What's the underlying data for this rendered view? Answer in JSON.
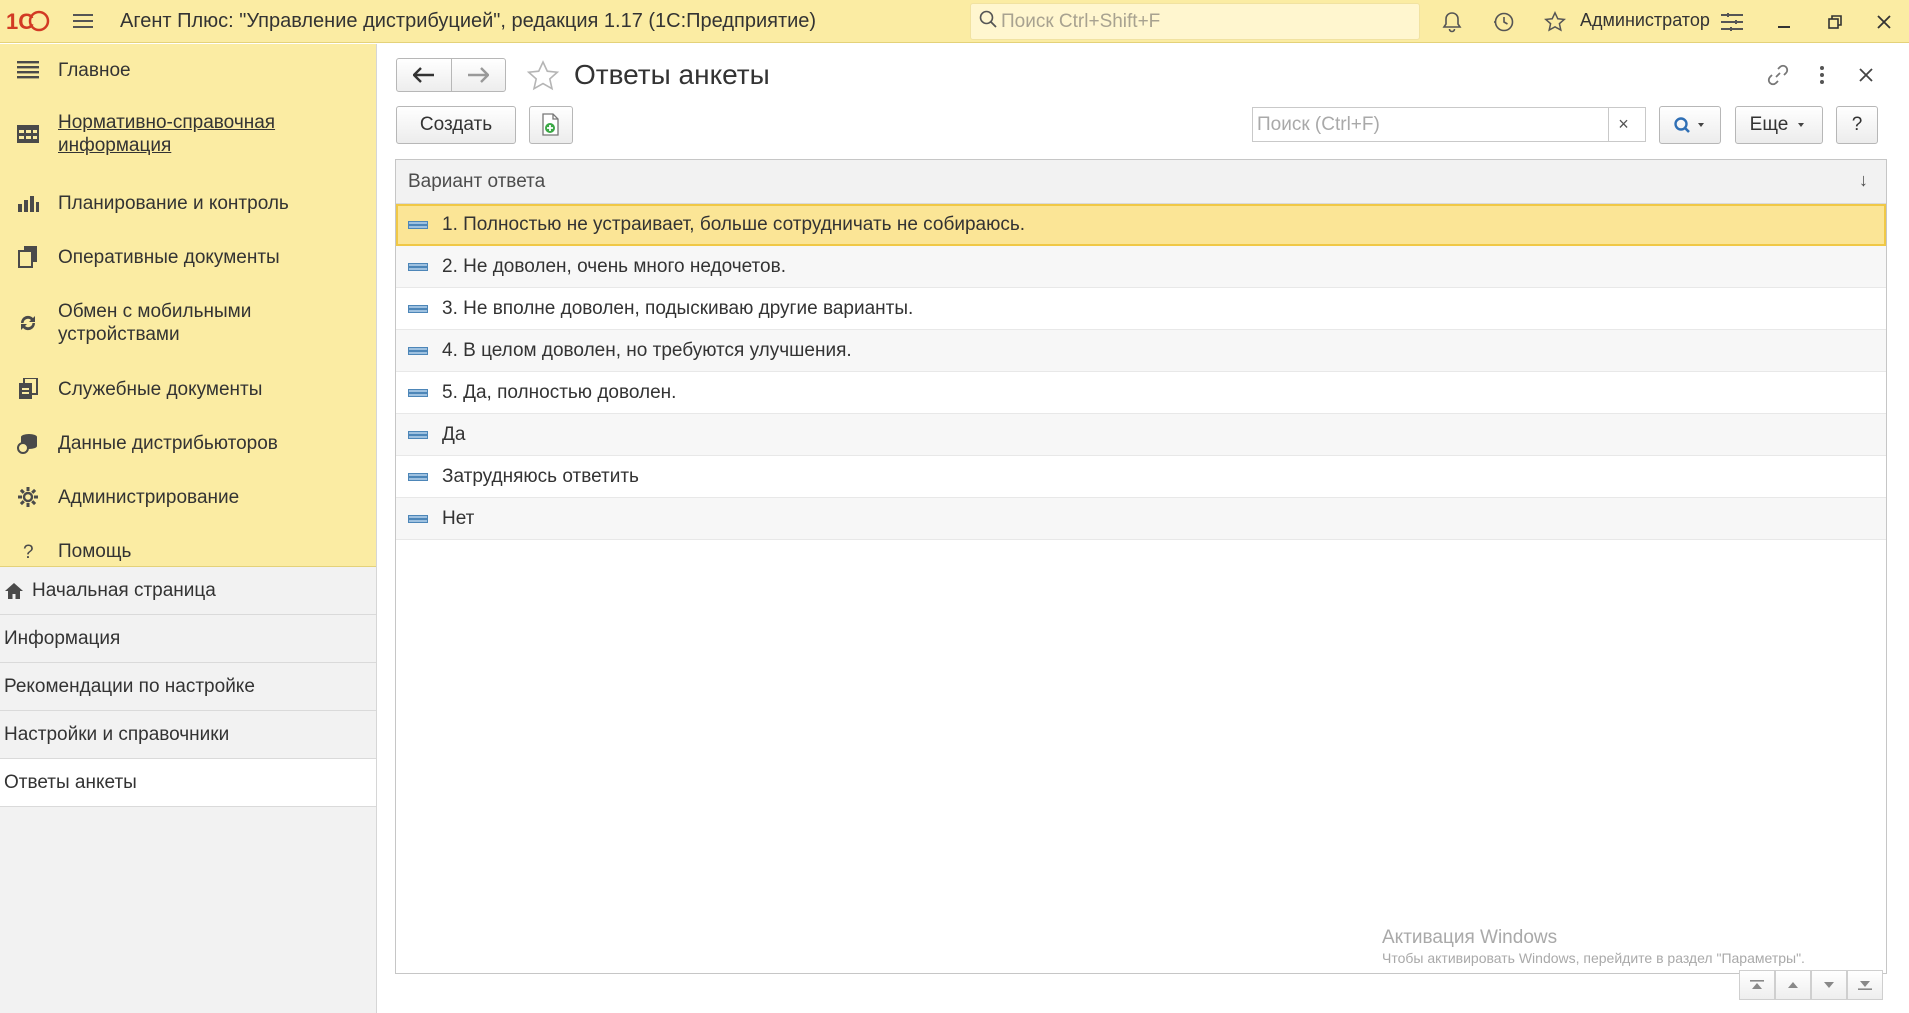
{
  "app": {
    "logo_text": "1С",
    "title": "Агент Плюс: \"Управление дистрибуцией\", редакция 1.17  (1С:Предприятие)",
    "search_placeholder": "Поиск Ctrl+Shift+F",
    "user": "Администратор",
    "icons": [
      "menu-icon",
      "bell-icon",
      "history-icon",
      "star-icon",
      "settings-icon",
      "minimize-icon",
      "restore-icon",
      "close-icon"
    ]
  },
  "sections": [
    {
      "label": "Главное",
      "icon": "menu-lines-icon"
    },
    {
      "label": "Нормативно-справочная информация",
      "icon": "table-icon",
      "active": true
    },
    {
      "label": "Планирование и контроль",
      "icon": "bar-chart-icon"
    },
    {
      "label": "Оперативные документы",
      "icon": "documents-icon"
    },
    {
      "label": "Обмен с мобильными устройствами",
      "icon": "sync-icon"
    },
    {
      "label": "Служебные документы",
      "icon": "service-docs-icon"
    },
    {
      "label": "Данные дистрибьюторов",
      "icon": "distributors-icon"
    },
    {
      "label": "Администрирование",
      "icon": "gear-icon"
    },
    {
      "label": "Помощь",
      "icon": "question-icon"
    }
  ],
  "open_windows": [
    {
      "label": "Начальная страница",
      "icon": "home-icon"
    },
    {
      "label": "Информация"
    },
    {
      "label": "Рекомендации по настройке"
    },
    {
      "label": "Настройки и справочники"
    },
    {
      "label": "Ответы анкеты",
      "current": true
    }
  ],
  "form": {
    "title": "Ответы анкеты",
    "create_label": "Создать",
    "search_placeholder": "Поиск (Ctrl+F)",
    "clear_label": "×",
    "more_label": "Еще",
    "help_label": "?",
    "column_header": "Вариант ответа",
    "sort_glyph": "↓"
  },
  "rows": [
    "1. Полностью не устраивает, больше сотрудничать не собираюсь.",
    "2. Не доволен, очень много недочетов.",
    "3. Не вполне доволен, подыскиваю другие варианты.",
    "4. В целом доволен, но требуются улучшения.",
    "5. Да, полностью доволен.",
    "Да",
    "Затрудняюсь ответить",
    "Нет"
  ],
  "selected_row": 0,
  "watermark": {
    "title": "Активация Windows",
    "subtitle": "Чтобы активировать Windows, перейдите в раздел \"Параметры\"."
  },
  "colors": {
    "topbar": "#fbeca3",
    "selection": "#fbe596",
    "accent": "#d9a400"
  }
}
